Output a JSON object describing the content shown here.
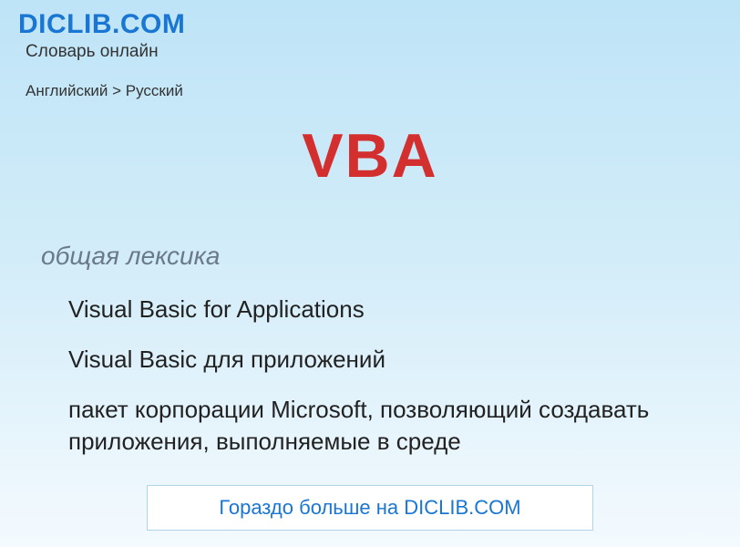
{
  "header": {
    "logo": "DICLIB.COM",
    "tagline": "Словарь онлайн"
  },
  "breadcrumb": {
    "text": "Английский > Русский"
  },
  "entry": {
    "title": "VBA",
    "category": "общая лексика",
    "definitions": [
      "Visual Basic for Applications",
      "Visual Basic для приложений",
      "пакет корпорации Microsoft, позволяющий создавать приложения, выполняемые в среде"
    ]
  },
  "banner": {
    "text": "Гораздо больше на DICLIB.COM"
  }
}
